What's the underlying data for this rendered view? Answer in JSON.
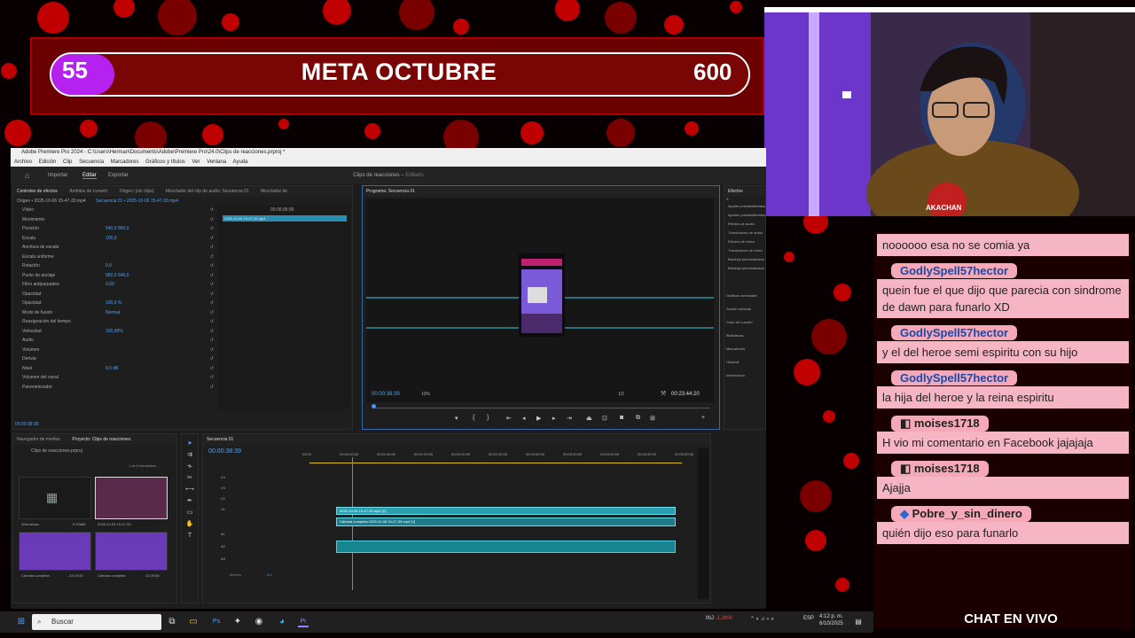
{
  "overlay": {
    "goal": {
      "current": "55",
      "title": "META OCTUBRE",
      "target": "600",
      "progress_fraction": 0.09,
      "fill_color": "#b522f0"
    },
    "webcam_badge": "AKACHAN",
    "chat_title": "CHAT EN VIVO",
    "chat_messages": [
      {
        "user": "",
        "text": "noooooo esa no se comia ya"
      },
      {
        "user": "GodlySpell57hector",
        "text": "quein fue el que dijo que parecia con sindrome de dawn para funarlo XD"
      },
      {
        "user": "GodlySpell57hector",
        "text": "y el del heroe semi espiritu con su hijo"
      },
      {
        "user": "GodlySpell57hector",
        "text": "la hija del heroe y la reina espiritu"
      },
      {
        "user": "moises1718",
        "text": "H vio mi comentario en Facebook jajajaja"
      },
      {
        "user": "moises1718",
        "text": "Ajajja"
      },
      {
        "user": "Pobre_y_sin_dinero",
        "text": "quién dijo eso para funarlo"
      }
    ]
  },
  "premiere": {
    "titlebar": "Adobe Premiere Pro 2024 - C:\\Users\\Herman\\Documents\\Adobe\\Premiere Pro\\24.0\\Clips de reacciones.prproj *",
    "menu": [
      "Archivo",
      "Edición",
      "Clip",
      "Secuencia",
      "Marcadores",
      "Gráficos y títulos",
      "Ver",
      "Ventana",
      "Ayuda"
    ],
    "workspace_tabs": [
      "Importar",
      "Editar",
      "Exportar"
    ],
    "active_workspace": "Editar",
    "project_title": "Clips de reacciones",
    "project_status": "Editado",
    "source_tabs": [
      "Controles de efectos",
      "Ámbitos de Lumetri",
      "Origen: (sin clips)",
      "Mezclador del clip de audio: Secuencia 01",
      "Mezclador de"
    ],
    "origin_line": "Origen • 2025-10-06 15-47-33.mp4",
    "sequence_line": "Secuencia 01 • 2025-10-06 15-47-33.mp4",
    "effect_clip_time": "00:05:00:00",
    "effect_clip_name": "2025-10-06 15-47-33.mp4",
    "effects_controls": [
      {
        "label": "Vídeo",
        "value": ""
      },
      {
        "label": "Movimiento",
        "value": ""
      },
      {
        "label": "Posición",
        "value": "540,0   960,0"
      },
      {
        "label": "Escala",
        "value": "100,0"
      },
      {
        "label": "Anchura de escala",
        "value": ""
      },
      {
        "label": "Escala uniforme",
        "value": ""
      },
      {
        "label": "Rotación",
        "value": "0,0"
      },
      {
        "label": "Punto de anclaje",
        "value": "960,0   540,0"
      },
      {
        "label": "Filtro antiparpadeo",
        "value": "0,00"
      },
      {
        "label": "Opacidad",
        "value": ""
      },
      {
        "label": "Opacidad",
        "value": "100,0 %"
      },
      {
        "label": "Modo de fusión",
        "value": "Normal"
      },
      {
        "label": "Reasignación del tiempo",
        "value": ""
      },
      {
        "label": "Velocidad",
        "value": "100,00%"
      },
      {
        "label": "Audio",
        "value": ""
      },
      {
        "label": "Volumen",
        "value": ""
      },
      {
        "label": "Derivar",
        "value": ""
      },
      {
        "label": "Nivel",
        "value": "0,0 dB"
      },
      {
        "label": "Volumen del canal",
        "value": ""
      },
      {
        "label": "Panoramizador",
        "value": ""
      }
    ],
    "effects_timecode": "00:00:38:39",
    "program_tab": "Programa: Secuencia 01",
    "program_timecode": "00:00:38:39",
    "program_zoom": "10%",
    "program_resolution": "1/2",
    "program_duration": "00:23:44:20",
    "effects_panel": {
      "tab": "Efectos",
      "folders": [
        "Ajustes preestablecidos",
        "Ajustes preestablecidos de Lumetri",
        "Efectos de audio",
        "Transiciones de audio",
        "Efectos de vídeo",
        "Transiciones de vídeo",
        "Bandeja personalizada 01",
        "Bandeja personalizada 02"
      ],
      "side_panels": [
        "Gráficos esenciales",
        "Sonido esencial",
        "Color de Lumetri",
        "Bibliotecas",
        "Marcadores",
        "Historial",
        "Información"
      ]
    },
    "project_panel": {
      "tabs": [
        "Navegador de medios",
        "Proyecto: Clips de reacciones"
      ],
      "file": "Clips de reacciones.prproj",
      "count": "1 de 6 elementos ...",
      "items": [
        {
          "name": "Whooshaw",
          "duration": "0:23668",
          "kind": "audio"
        },
        {
          "name": "2025-10-06 15-47-33",
          "duration": "",
          "kind": "video"
        },
        {
          "name": "Cámara completa",
          "duration": "23:19:25",
          "kind": "cam"
        },
        {
          "name": "Cámara completa",
          "duration": "23:29:56",
          "kind": "cam"
        }
      ]
    },
    "timeline": {
      "tab": "Secuencia 01",
      "timecode": "00:00:38:39",
      "ruler": [
        "00:00",
        "00:00:30:00",
        "00:01:00:00",
        "00:01:30:00",
        "00:02:00:00",
        "00:02:30:00",
        "00:03:00:00",
        "00:03:30:00",
        "00:04:00:00",
        "00:04:30:00",
        "00:05:00:00"
      ],
      "video_tracks": [
        "V4",
        "V3",
        "V2",
        "V1"
      ],
      "audio_tracks": [
        "A1",
        "A2",
        "A3"
      ],
      "mix_label": "Mezcla",
      "mix_value": "0,0",
      "clip_v2": "2025-10-06 15-47-33.mp4 [V]",
      "clip_v1": "Cámara completa 2025-10-06 15-47-33.mp4 [V]"
    }
  },
  "taskbar": {
    "search_placeholder": "Buscar",
    "stock_name": "INJ",
    "stock_change": "-1,26%",
    "lang": "ESP",
    "time": "4:12 p. m.",
    "date": "6/10/2025"
  }
}
